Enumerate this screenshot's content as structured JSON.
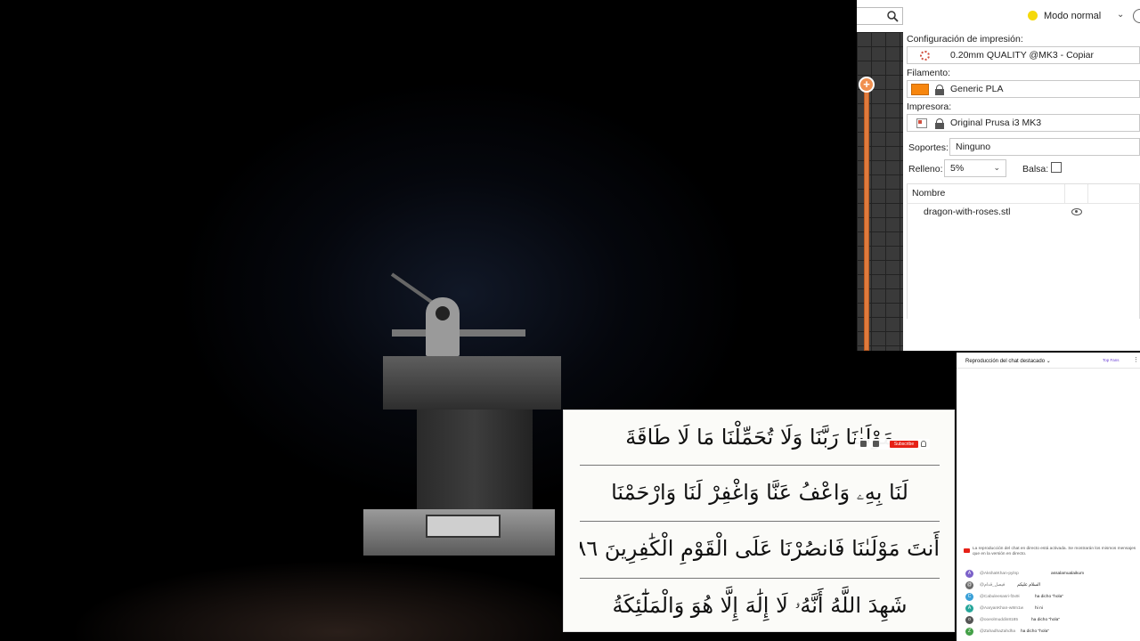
{
  "slicer": {
    "mode_label": "Modo normal",
    "print_settings_label": "Configuración de impresión:",
    "print_profile": "0.20mm QUALITY @MK3 - Copiar",
    "filament_label": "Filamento:",
    "filament_value": "Generic PLA",
    "filament_color": "#f7860e",
    "printer_label": "Impresora:",
    "printer_value": "Original Prusa i3 MK3",
    "supports_label": "Soportes:",
    "supports_value": "Ninguno",
    "infill_label": "Relleno:",
    "infill_value": "5%",
    "raft_label": "Balsa:",
    "raft_checked": false,
    "object_list": {
      "header_name": "Nombre",
      "objects": [
        {
          "name": "dragon-with-roses.stl",
          "visible": true
        }
      ]
    }
  },
  "chat": {
    "title": "Reproducción del chat destacado ⌄",
    "top_fans": "Top Fans",
    "notice": "La reproducción del chat en directo está activada. Se mostrarán los mismos mensajes que en la versión en directo.",
    "messages": [
      {
        "avatar": "A",
        "avatar_color": "#7b61c9",
        "author": "@AkshatKhan-pylnp",
        "text": "assalamualaikum"
      },
      {
        "avatar": "@",
        "avatar_color": "#6a6a6a",
        "author": "@فيصل_قدام",
        "text": "السلام عليكم"
      },
      {
        "avatar": "C",
        "avatar_color": "#3aa0d8",
        "author": "@Cabuleesasri-f3x9i",
        "text": "ha dicho \"hola\""
      },
      {
        "avatar": "A",
        "avatar_color": "#26a69a",
        "author": "@AaryanKhan-w8m1w",
        "text": "hi ni"
      },
      {
        "avatar": "o",
        "avatar_color": "#555555",
        "author": "@ooeolmuddin8185",
        "text": "ha dicho \"hola\""
      },
      {
        "avatar": "Z",
        "avatar_color": "#43a047",
        "author": "@ZahadhaZahdha",
        "text": "ha dicho \"hola\""
      }
    ]
  },
  "overlay": {
    "subscribe_label": "Subscribe",
    "quran_lines": [
      "مَوْلَىٰنَا رَبَّنَا وَلَا تُحَمِّلْنَا مَا لَا طَاقَةَ",
      "لَنَا بِهِۦ وَاعْفُ عَنَّا وَاغْفِرْ لَنَا وَارْحَمْنَا",
      "أَنتَ مَوْلَىٰنَا فَانصُرْنَا عَلَى الْقَوْمِ الْكَٰفِرِينَ ٢٨٦",
      "شَهِدَ اللَّهُ أَنَّهُۥ لَا إِلَٰهَ إِلَّا هُوَ وَالْمَلَٰٓئِكَةُ"
    ]
  }
}
